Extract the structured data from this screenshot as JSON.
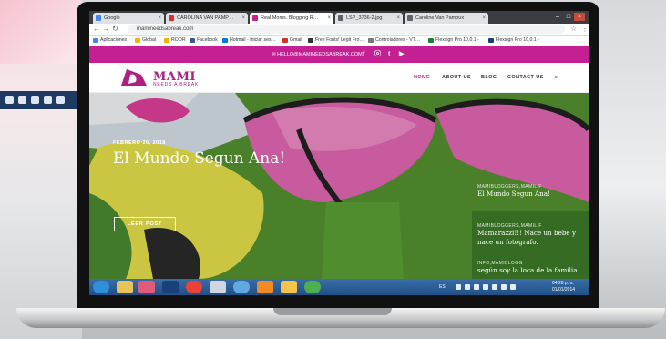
{
  "browser": {
    "tabs": [
      {
        "label": "Google",
        "color": "#4285f4"
      },
      {
        "label": "CAROLINA VAN PAMP…",
        "color": "#d93025"
      },
      {
        "label": "Real Moms. Blogging R…",
        "color": "#c41f93",
        "active": true
      },
      {
        "label": "LSP_3736-2.jpg",
        "color": "#5f6368"
      },
      {
        "label": "Caroline Van Pamoux |",
        "color": "#5f6368"
      }
    ],
    "url": "mamineedsabreak.com",
    "bookmarks": [
      {
        "label": "Aplicaciones",
        "color": "#4285f4"
      },
      {
        "label": "Global",
        "color": "#f4b400"
      },
      {
        "label": "ROOR",
        "color": "#f4b400"
      },
      {
        "label": "Facebook",
        "color": "#3b5998"
      },
      {
        "label": "Hotmail - Iniciar ses…",
        "color": "#0078d7"
      },
      {
        "label": "Gmail",
        "color": "#d93025"
      },
      {
        "label": "Free Fonts! Legit Fro…",
        "color": "#333333"
      },
      {
        "label": "Controladores - VT…",
        "color": "#777777"
      },
      {
        "label": "Flexsign Pro 10.0.1 -",
        "color": "#1a7f37"
      },
      {
        "label": "Flexsign Pro 10.0.1 -",
        "color": "#1a3f7f"
      }
    ]
  },
  "site": {
    "email": "HELLO@MAMINEEDSABREAK.COM",
    "social": [
      "f",
      "ⓞ",
      "t",
      "▶"
    ],
    "logo_title": "MAMI",
    "logo_sub": "NEEDS A BREAK",
    "nav": [
      "HOME",
      "ABOUT US",
      "BLOG",
      "CONTACT US"
    ],
    "hero": {
      "date": "FEBRERO 26, 2018",
      "title": "El Mundo Segun Ana!",
      "button": "LEER POST"
    },
    "sidebar": [
      {
        "category": "MAMIBLOGGERS,MAMILIF",
        "title": "El Mundo Segun Ana!"
      },
      {
        "category": "MAMIBLOGGERS,MAMILIF",
        "title": "Mamarazzi!!! Nace un bebe y nace un fotógrafo."
      },
      {
        "category": "INFO,MAMIBLOGG",
        "title": "según soy la loca de la familia."
      }
    ]
  },
  "taskbar": {
    "apps": [
      {
        "name": "start-orb",
        "color": "#2f8fd8"
      },
      {
        "name": "explorer",
        "color": "#e8c25c"
      },
      {
        "name": "paint",
        "color": "#e05a7a"
      },
      {
        "name": "photoshop",
        "color": "#1b3f78"
      },
      {
        "name": "chrome",
        "color": "#ea4335"
      },
      {
        "name": "document",
        "color": "#cfd6df"
      },
      {
        "name": "network",
        "color": "#5fa8e0"
      },
      {
        "name": "illustrator",
        "color": "#f08a24"
      },
      {
        "name": "gallery",
        "color": "#f6c44a"
      },
      {
        "name": "chrome-2",
        "color": "#4caf50"
      }
    ],
    "language": "ES",
    "time": "04:28 p.m.",
    "date": "01/01/2014"
  }
}
